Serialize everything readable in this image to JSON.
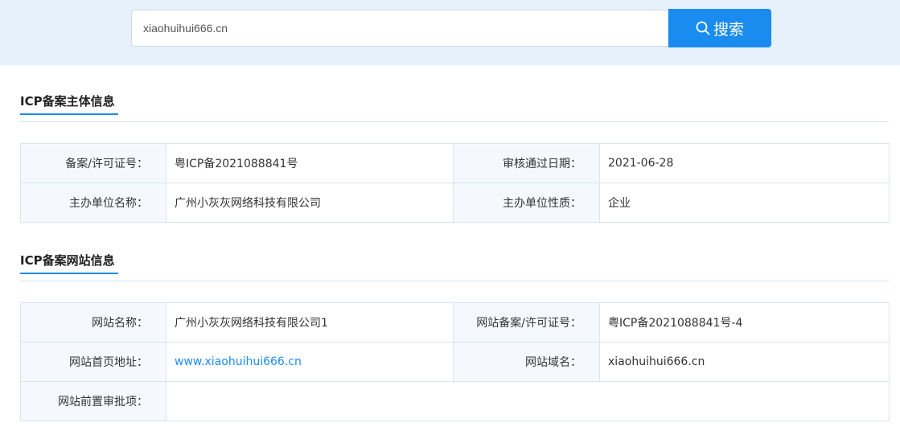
{
  "search": {
    "value": "xiaohuihui666.cn",
    "button_label": "搜索",
    "icon": "search-icon"
  },
  "subject_section": {
    "title": "ICP备案主体信息",
    "rows": [
      [
        {
          "label": "备案/许可证号：",
          "value": "粤ICP备2021088841号"
        },
        {
          "label": "审核通过日期：",
          "value": "2021-06-28"
        }
      ],
      [
        {
          "label": "主办单位名称：",
          "value": "广州小灰灰网络科技有限公司"
        },
        {
          "label": "主办单位性质：",
          "value": "企业"
        }
      ]
    ]
  },
  "website_section": {
    "title": "ICP备案网站信息",
    "rows": [
      [
        {
          "label": "网站名称：",
          "value": "广州小灰灰网络科技有限公司1"
        },
        {
          "label": "网站备案/许可证号：",
          "value": "粤ICP备2021088841号-4"
        }
      ],
      [
        {
          "label": "网站首页地址：",
          "value": "www.xiaohuihui666.cn"
        },
        {
          "label": "网站域名：",
          "value": "xiaohuihui666.cn"
        }
      ],
      [
        {
          "label": "网站前置审批项：",
          "value": ""
        }
      ]
    ]
  },
  "colors": {
    "accent": "#1a8cf0",
    "search_band": "#e6f1fc",
    "label_bg": "#f5f9fd",
    "border": "#dbe3ec"
  }
}
